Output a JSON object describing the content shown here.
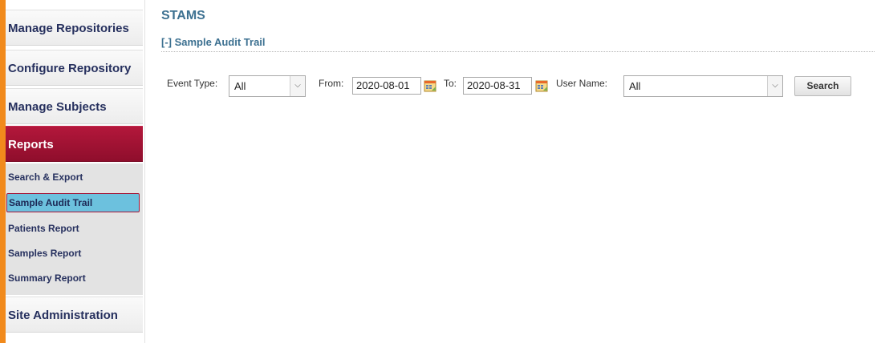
{
  "sidebar": {
    "items": [
      {
        "label": "Manage Repositories"
      },
      {
        "label": "Configure Repository"
      },
      {
        "label": "Manage Subjects"
      },
      {
        "label": "Reports"
      },
      {
        "label": "Site Administration"
      }
    ],
    "subitems": [
      {
        "label": "Search & Export"
      },
      {
        "label": "Sample Audit Trail"
      },
      {
        "label": "Patients Report"
      },
      {
        "label": "Samples Report"
      },
      {
        "label": "Summary Report"
      }
    ]
  },
  "main": {
    "title": "STAMS",
    "section_title": "[-] Sample Audit Trail"
  },
  "filters": {
    "event_type_label": "Event Type:",
    "event_type_value": "All",
    "from_label": "From:",
    "from_value": "2020-08-01",
    "to_label": "To:",
    "to_value": "2020-08-31",
    "user_name_label": "User Name:",
    "user_name_value": "All",
    "search_label": "Search"
  },
  "colors": {
    "accent": "#9e1233",
    "highlight": "#6cc1de",
    "heading": "#3d7191",
    "edge_bar": "#f18a1c"
  }
}
